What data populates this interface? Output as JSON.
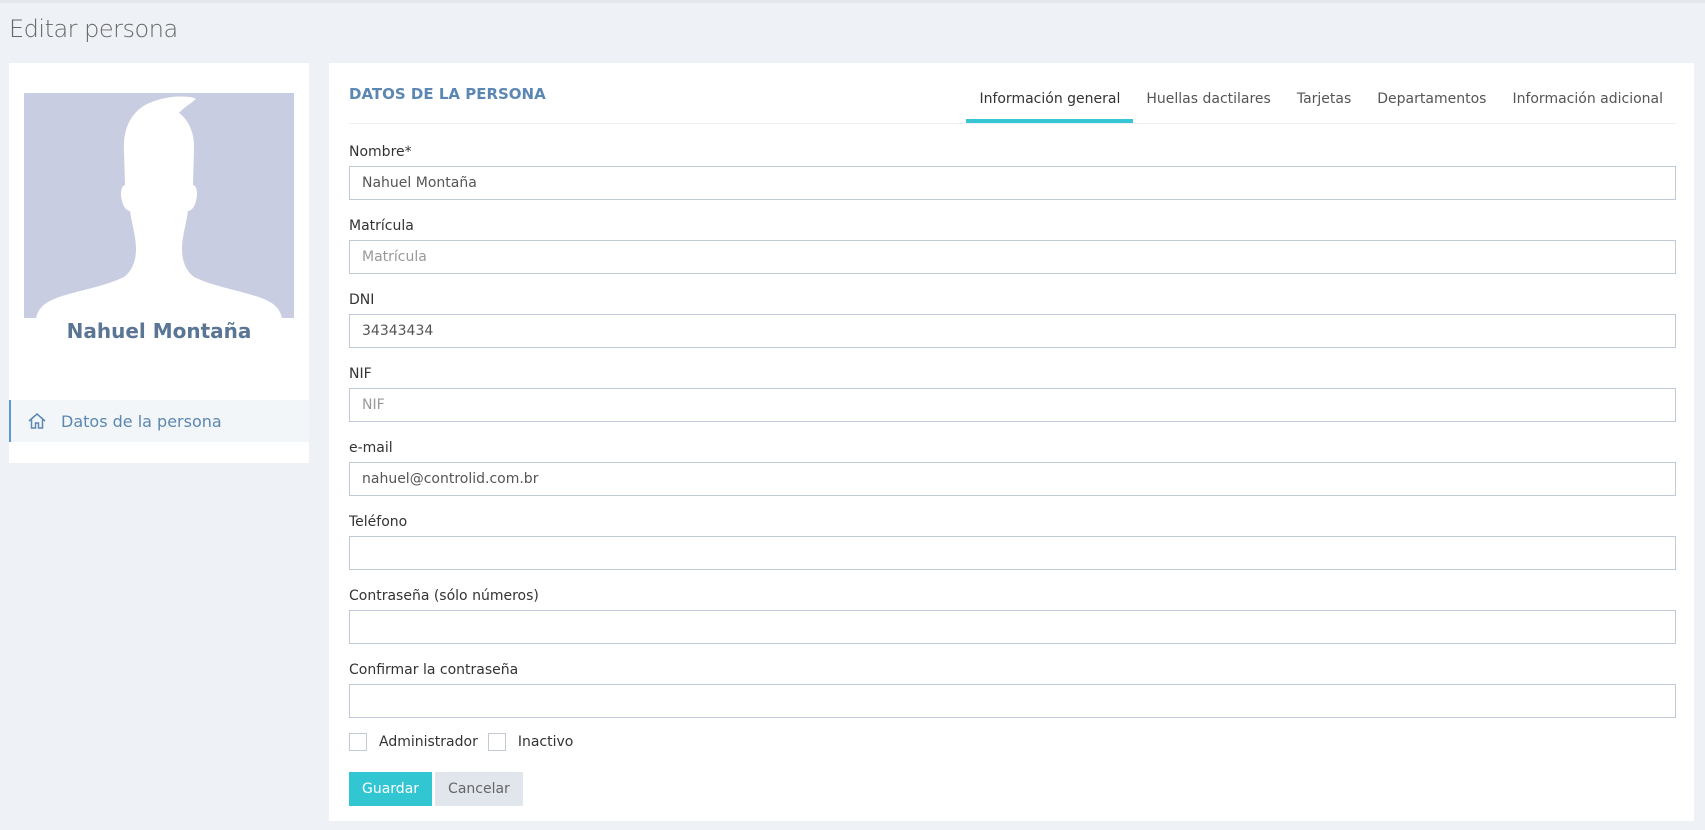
{
  "page": {
    "title": "Editar persona"
  },
  "profile": {
    "name": "Nahuel Montaña",
    "menu_item": "Datos de la persona"
  },
  "main": {
    "caption": "DATOS DE LA PERSONA",
    "tabs": [
      {
        "label": "Información general",
        "active": true
      },
      {
        "label": "Huellas dactilares",
        "active": false
      },
      {
        "label": "Tarjetas",
        "active": false
      },
      {
        "label": "Departamentos",
        "active": false
      },
      {
        "label": "Información adicional",
        "active": false
      }
    ]
  },
  "form": {
    "nombre": {
      "label": "Nombre*",
      "value": "Nahuel Montaña",
      "placeholder": ""
    },
    "matricula": {
      "label": "Matrícula",
      "value": "",
      "placeholder": "Matrícula"
    },
    "dni": {
      "label": "DNI",
      "value": "34343434",
      "placeholder": ""
    },
    "nif": {
      "label": "NIF",
      "value": "",
      "placeholder": "NIF"
    },
    "email": {
      "label": "e-mail",
      "value": "nahuel@controlid.com.br",
      "placeholder": ""
    },
    "telefono": {
      "label": "Teléfono",
      "value": "",
      "placeholder": ""
    },
    "contrasena": {
      "label": "Contraseña (sólo números)",
      "value": "",
      "placeholder": ""
    },
    "confirmar": {
      "label": "Confirmar la contraseña",
      "value": "",
      "placeholder": ""
    },
    "administrador": {
      "label": "Administrador",
      "checked": false
    },
    "inactivo": {
      "label": "Inactivo",
      "checked": false
    },
    "save_label": "Guardar",
    "cancel_label": "Cancelar"
  },
  "colors": {
    "accent": "#32c5d2",
    "link": "#5b87b2",
    "avatar_bg": "#c8cde2"
  }
}
